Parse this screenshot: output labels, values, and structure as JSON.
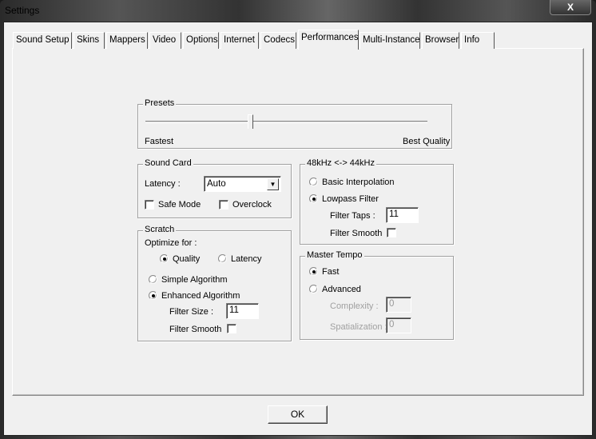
{
  "window": {
    "title": "Settings",
    "close_label": "X"
  },
  "tabs": [
    {
      "label": "Sound Setup"
    },
    {
      "label": "Skins"
    },
    {
      "label": "Mappers"
    },
    {
      "label": "Video"
    },
    {
      "label": "Options"
    },
    {
      "label": "Internet"
    },
    {
      "label": "Codecs"
    },
    {
      "label": "Performances",
      "selected": true
    },
    {
      "label": "Multi-Instance"
    },
    {
      "label": "Browser"
    },
    {
      "label": "Info"
    }
  ],
  "presets": {
    "label": "Presets",
    "min_label": "Fastest",
    "max_label": "Best Quality",
    "value_fraction": 0.37
  },
  "sound_card": {
    "label": "Sound Card",
    "latency_label": "Latency :",
    "latency_value": "Auto",
    "safe_mode_label": "Safe Mode",
    "safe_mode": false,
    "overclock_label": "Overclock",
    "overclock": false
  },
  "scratch": {
    "label": "Scratch",
    "optimize_label": "Optimize for :",
    "quality_label": "Quality",
    "latency_label": "Latency",
    "simple_label": "Simple Algorithm",
    "enhanced_label": "Enhanced Algorithm",
    "filter_size_label": "Filter Size :",
    "filter_size_value": "11",
    "filter_smooth_label": "Filter Smooth"
  },
  "resample": {
    "label": "48kHz <-> 44kHz",
    "basic_label": "Basic Interpolation",
    "lowpass_label": "Lowpass Filter",
    "filter_taps_label": "Filter Taps :",
    "filter_taps_value": "11",
    "filter_smooth_label": "Filter Smooth"
  },
  "master_tempo": {
    "label": "Master Tempo",
    "fast_label": "Fast",
    "advanced_label": "Advanced",
    "complexity_label": "Complexity :",
    "complexity_value": "0",
    "spatialization_label": "Spatialization :",
    "spatialization_value": "0"
  },
  "ok_label": "OK"
}
